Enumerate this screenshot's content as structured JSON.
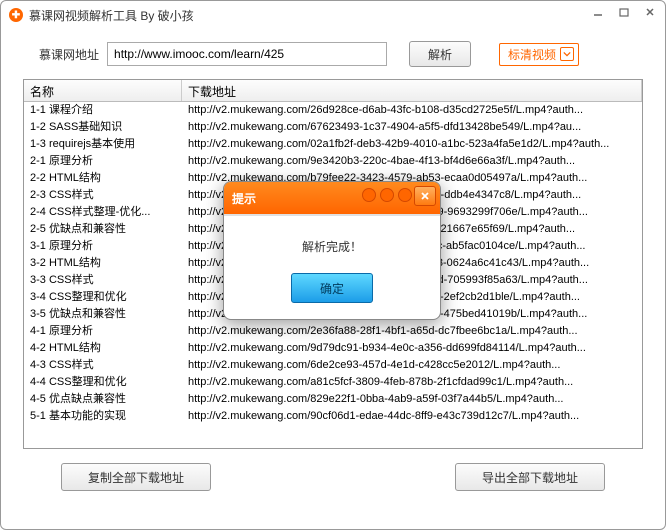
{
  "window": {
    "title": "慕课网视频解析工具 By 破小孩"
  },
  "urlbar": {
    "label": "慕课网地址",
    "value": "http://www.imooc.com/learn/425",
    "parse_btn": "解析",
    "quality": "标清视频"
  },
  "table": {
    "col_name": "名称",
    "col_url": "下载地址",
    "rows": [
      {
        "name": "1-1 课程介绍",
        "url": "http://v2.mukewang.com/26d928ce-d6ab-43fc-b108-d35cd2725e5f/L.mp4?auth..."
      },
      {
        "name": "1-2 SASS基础知识",
        "url": "http://v2.mukewang.com/67623493-1c37-4904-a5f5-dfd13428be549/L.mp4?au..."
      },
      {
        "name": "1-3 requirejs基本使用",
        "url": "http://v2.mukewang.com/02a1fb2f-deb3-42b9-4010-a1bc-523a4fa5e1d2/L.mp4?auth..."
      },
      {
        "name": "2-1 原理分析",
        "url": "http://v2.mukewang.com/9e3420b3-220c-4bae-4f13-bf4d6e66a3f/L.mp4?auth..."
      },
      {
        "name": "2-2 HTML结构",
        "url": "http://v2.mukewang.com/b79fee22-3423-4579-ab53-ecaa0d05497a/L.mp4?auth..."
      },
      {
        "name": "2-3 CSS样式",
        "url": "http://v2.mukewang.com/7d3e6fa7-3374-4343-974d-ddb4e4347c8/L.mp4?auth..."
      },
      {
        "name": "2-4 CSS样式整理-优化...",
        "url": "http://v2.mukewang.com/5e3b3201-b02e-4543-96e9-9693299f706e/L.mp4?auth..."
      },
      {
        "name": "2-5 优缺点和兼容性",
        "url": "http://v2.mukewang.com/4ea728e9-c8f1-45fd-98fb-f21667e65f69/L.mp4?auth..."
      },
      {
        "name": "3-1 原理分析",
        "url": "http://v2.mukewang.com/b5a31d54-2838-4eee-ac2c-ab5fac0104ce/L.mp4?auth..."
      },
      {
        "name": "3-2 HTML结构",
        "url": "http://v2.mukewang.com/66b2b4b2-e30c-45b0-8908-0624a6c41c43/L.mp4?auth..."
      },
      {
        "name": "3-3 CSS样式",
        "url": "http://v2.mukewang.com/338439e3-d1e4-4ab1-888d-705993f85a63/L.mp4?auth..."
      },
      {
        "name": "3-4 CSS整理和优化",
        "url": "http://v2.mukewang.com/9639c6df-3e37-4998-9186-2ef2cb2d1ble/L.mp4?auth..."
      },
      {
        "name": "3-5 优缺点和兼容性",
        "url": "http://v2.mukewang.com/7ee93e55-f88c-4e1a-9a92-475bed41019b/L.mp4?auth..."
      },
      {
        "name": "4-1 原理分析",
        "url": "http://v2.mukewang.com/2e36fa88-28f1-4bf1-a65d-dc7fbee6bc1a/L.mp4?auth..."
      },
      {
        "name": "4-2 HTML结构",
        "url": "http://v2.mukewang.com/9d79dc91-b934-4e0c-a356-dd699fd84114/L.mp4?auth..."
      },
      {
        "name": "4-3 CSS样式",
        "url": "http://v2.mukewang.com/6de2ce93-457d-4e1d-c428cc5e2012/L.mp4?auth..."
      },
      {
        "name": "4-4 CSS整理和优化",
        "url": "http://v2.mukewang.com/a81c5fcf-3809-4feb-878b-2f1cfdad99c1/L.mp4?auth..."
      },
      {
        "name": "4-5 优点缺点兼容性",
        "url": "http://v2.mukewang.com/829e22f1-0bba-4ab9-a59f-03f7a44b5/L.mp4?auth..."
      },
      {
        "name": "5-1 基本功能的实现",
        "url": "http://v2.mukewang.com/90cf06d1-edae-44dc-8ff9-e43c739d12c7/L.mp4?auth..."
      }
    ]
  },
  "footer": {
    "copy_all": "复制全部下载地址",
    "export_all": "导出全部下载地址"
  },
  "dialog": {
    "title": "提示",
    "message": "解析完成！",
    "ok": "确定"
  }
}
